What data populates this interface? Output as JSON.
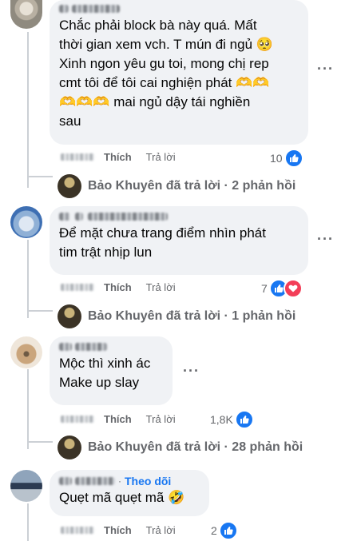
{
  "comments": [
    {
      "text": "Chắc phải block bà này quá. Mất thời gian xem vch. T mún đi ngủ 🥺 Xinh ngon yêu gu toi, mong chị rep cmt tôi để tôi cai nghiện phát 🫶🫶 🫶🫶🫶 mai ngủ dậy tái nghiền sau",
      "lines": [
        "Chắc phải block bà này quá. Mất",
        "thời gian xem vch. T mún đi ngủ 🥺",
        "Xinh ngon yêu gu toi, mong chị rep",
        "cmt tôi để tôi cai nghiện phát 🫶🫶",
        "🫶🫶🫶 mai ngủ dậy tái nghiền",
        "sau"
      ],
      "like_label": "Thích",
      "reply_label": "Trả lời",
      "reaction_count": "10",
      "reactions": [
        "like"
      ],
      "reply_summary": "Bảo Khuyên đã trả lời · 2 phản hồi"
    },
    {
      "lines": [
        "Để mặt chưa trang điểm nhìn phát",
        "tim trật nhịp lun"
      ],
      "like_label": "Thích",
      "reply_label": "Trả lời",
      "reaction_count": "7",
      "reactions": [
        "like",
        "heart"
      ],
      "reply_summary": "Bảo Khuyên đã trả lời · 1 phản hồi"
    },
    {
      "lines": [
        "Mộc thì xinh ác",
        "Make up slay"
      ],
      "like_label": "Thích",
      "reply_label": "Trả lời",
      "reaction_count": "1,8K",
      "reactions": [
        "like"
      ],
      "reply_summary": "Bảo Khuyên đã trả lời · 28 phản hồi"
    },
    {
      "follow_label": "Theo dõi",
      "lines": [
        "Quẹt mã quẹt mã 🤣"
      ],
      "like_label": "Thích",
      "reply_label": "Trả lời",
      "reaction_count": "2",
      "reactions": [
        "like"
      ]
    }
  ],
  "more_glyph": "···",
  "colors": {
    "like": "#1877f2",
    "heart": "#f33e58",
    "bubble": "#f0f2f5",
    "meta": "#65676b"
  }
}
